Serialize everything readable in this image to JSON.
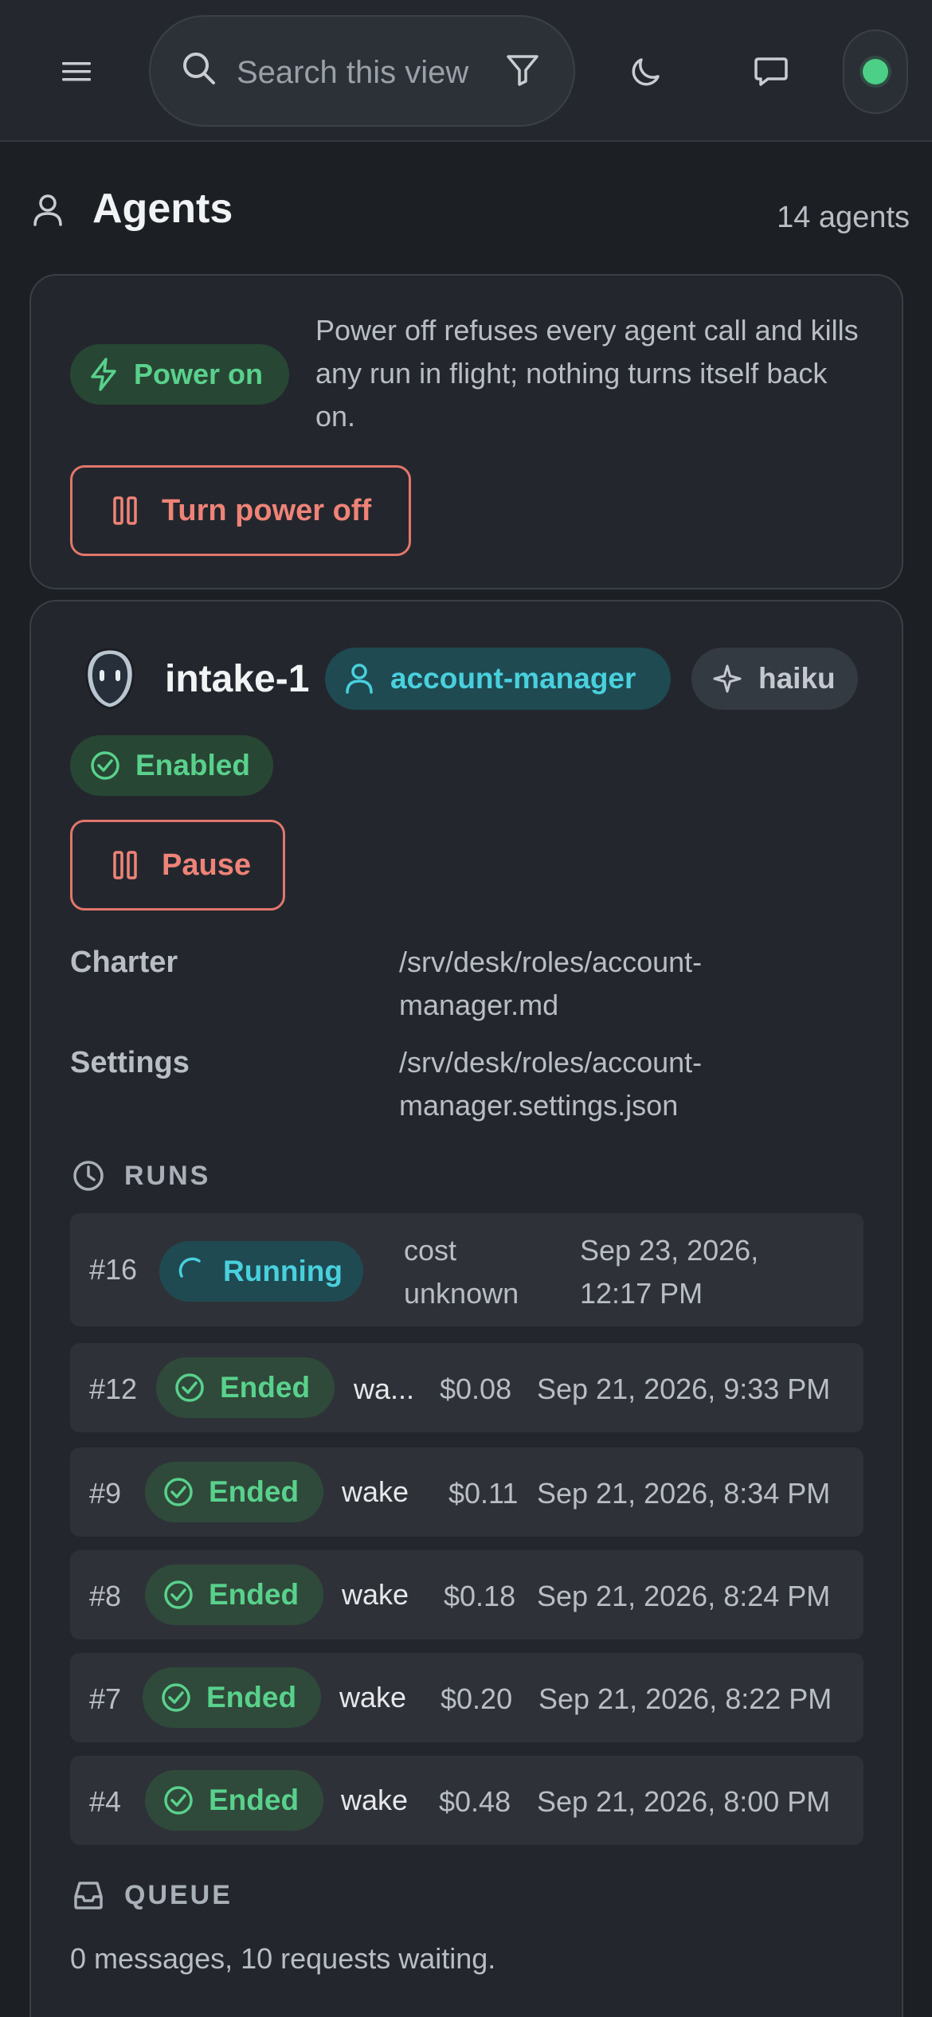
{
  "topbar": {
    "search_placeholder": "Search this view",
    "icons": [
      "menu-icon",
      "search-icon",
      "filter-icon",
      "moon-icon",
      "chat-icon",
      "status-dot"
    ]
  },
  "page": {
    "title": "Agents",
    "count": "14 agents"
  },
  "power": {
    "badge": "Power on",
    "description": "Power off refuses every agent call and kills any run in flight; nothing turns itself back on.",
    "button": "Turn power off"
  },
  "agent": {
    "name": "intake-1",
    "role": "account-manager",
    "model": "haiku",
    "status": "Enabled",
    "pause_label": "Pause",
    "charter_label": "Charter",
    "charter_value": "/srv/desk/roles/account-manager.md",
    "settings_label": "Settings",
    "settings_value": "/srv/desk/roles/account-manager.settings.json",
    "runs_heading": "RUNS",
    "runs": [
      {
        "num": "#16",
        "status": "Running",
        "trigger": "",
        "cost": "cost unknown",
        "time": "Sep 23, 2026, 12:17 PM"
      },
      {
        "num": "#12",
        "status": "Ended",
        "trigger": "wa...",
        "cost": "$0.08",
        "time": "Sep 21, 2026, 9:33 PM"
      },
      {
        "num": "#9",
        "status": "Ended",
        "trigger": "wake",
        "cost": "$0.11",
        "time": "Sep 21, 2026, 8:34 PM"
      },
      {
        "num": "#8",
        "status": "Ended",
        "trigger": "wake",
        "cost": "$0.18",
        "time": "Sep 21, 2026, 8:24 PM"
      },
      {
        "num": "#7",
        "status": "Ended",
        "trigger": "wake",
        "cost": "$0.20",
        "time": "Sep 21, 2026, 8:22 PM"
      },
      {
        "num": "#4",
        "status": "Ended",
        "trigger": "wake",
        "cost": "$0.48",
        "time": "Sep 21, 2026, 8:00 PM"
      }
    ],
    "queue_heading": "QUEUE",
    "queue_text": "0 messages, 10 requests waiting."
  },
  "colors": {
    "background": "#1c1f24",
    "card": "#23272d",
    "green": "#59d18c",
    "teal": "#49d0dd",
    "danger": "#ef8378"
  }
}
